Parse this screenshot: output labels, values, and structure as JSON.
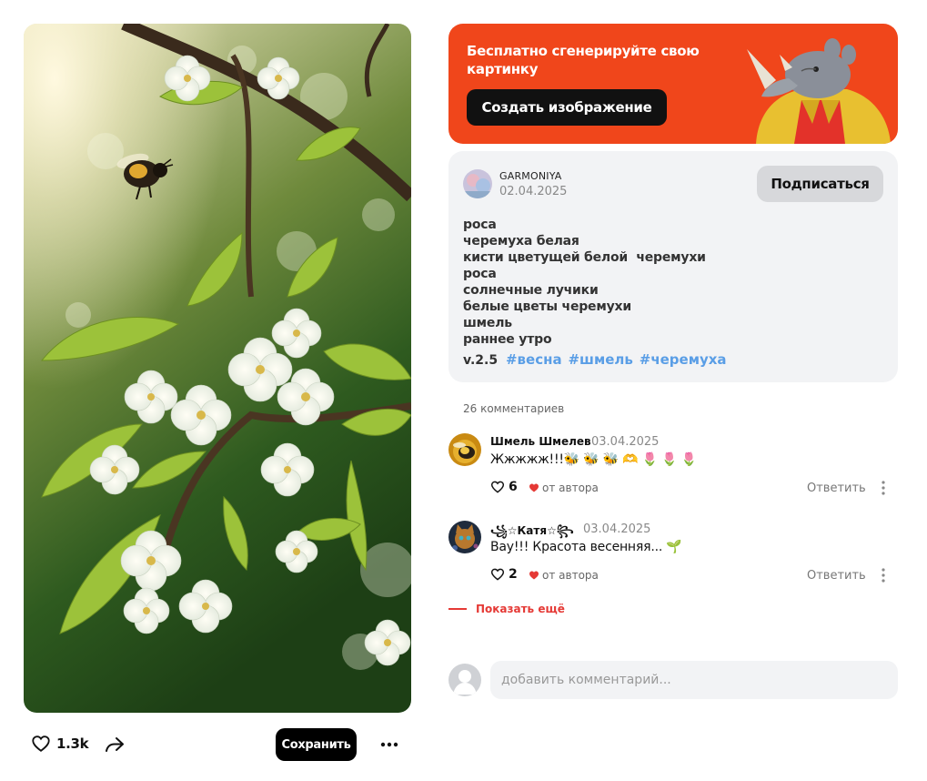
{
  "post": {
    "like_count": "1.3k",
    "save_label": "Сохранить"
  },
  "promo": {
    "title": "Бесплатно сгенерируйте свою картинку",
    "button_label": "Создать изображение",
    "brand_color": "#f0461b"
  },
  "author": {
    "name": "GARMONIYA",
    "date": "02.04.2025",
    "subscribe_label": "Подписаться"
  },
  "description": {
    "lines": [
      "роса",
      "черемуха белая",
      "кисти цветущей белой  черемухи",
      "роса",
      "солнечные лучики",
      "белые цветы черемухи",
      "шмель",
      "раннее утро"
    ],
    "version": "v.2.5",
    "hashtags": [
      "#весна",
      "#шмель",
      "#черемуха"
    ],
    "hashtag_color": "#5a9ee6"
  },
  "comments": {
    "count_label": "26 комментариев",
    "items": [
      {
        "author": "Шмель Шмелев",
        "date": "03.04.2025",
        "text": "Жжжжж!!!🐝 🐝 🐝 🫶 🌷 🌷 🌷",
        "likes": "6",
        "author_like_label": "от автора",
        "reply_label": "Ответить"
      },
      {
        "author": "꧁☆Катя☆꧂",
        "date": "03.04.2025",
        "text": "Вау!!! Красота весенняя... 🌱",
        "likes": "2",
        "author_like_label": "от автора",
        "reply_label": "Ответить"
      }
    ],
    "show_more_label": "Показать ещё",
    "add_placeholder": "добавить комментарий..."
  }
}
